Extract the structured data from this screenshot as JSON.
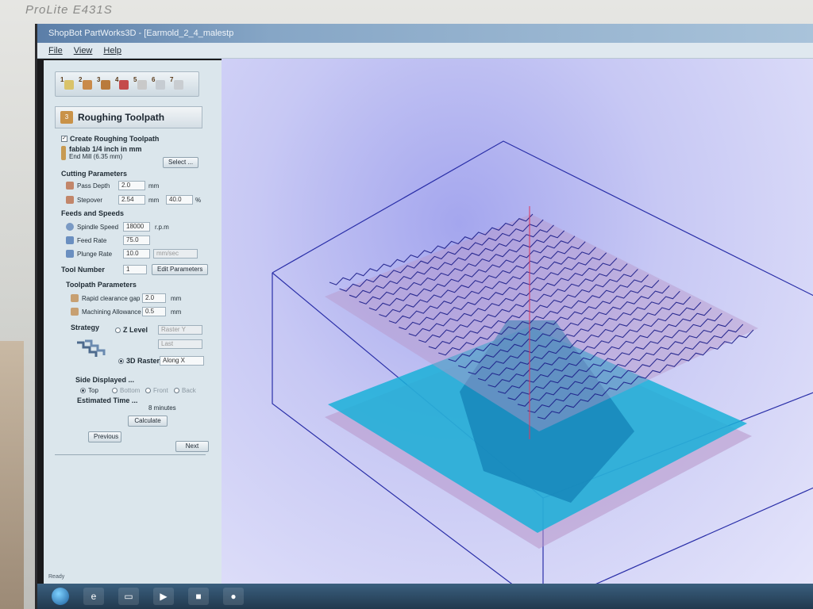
{
  "monitor": {
    "brand": "ProLite E431S"
  },
  "window": {
    "title": "ShopBot PartWorks3D - [Earmold_2_4_malestp"
  },
  "menu": [
    "File",
    "View",
    "Help"
  ],
  "steps": [
    "1",
    "2",
    "3",
    "4",
    "5",
    "6",
    "7"
  ],
  "panel": {
    "heading": "Roughing Toolpath",
    "create_label": "Create Roughing Toolpath",
    "create_checked": true,
    "tool_name": "fablab 1/4 inch in mm",
    "tool_type": "End Mill (6.35 mm)",
    "select_button": "Select ...",
    "cutting_title": "Cutting Parameters",
    "pass_depth_label": "Pass Depth",
    "pass_depth_value": "2.0",
    "pass_depth_unit": "mm",
    "stepover_label": "Stepover",
    "stepover_value": "2.54",
    "stepover_unit": "mm",
    "stepover_pct": "40.0",
    "pct_sign": "%",
    "feeds_title": "Feeds and Speeds",
    "spindle_label": "Spindle Speed",
    "spindle_value": "18000",
    "spindle_unit": "r.p.m",
    "feed_label": "Feed Rate",
    "feed_value": "75.0",
    "plunge_label": "Plunge Rate",
    "plunge_value": "10.0",
    "rate_unit": "mm/sec",
    "tool_number_label": "Tool Number",
    "tool_number_value": "1",
    "edit_params_button": "Edit Parameters",
    "toolpath_title": "Toolpath Parameters",
    "clearance_label": "Rapid clearance gap",
    "clearance_value": "2.0",
    "clearance_unit": "mm",
    "allowance_label": "Machining Allowance",
    "allowance_value": "0.5",
    "allowance_unit": "mm",
    "strategy_label": "Strategy",
    "zlevel_label": "Z Level",
    "zlevel_select": "Raster Y",
    "zlevel_select2": "Last",
    "raster_label": "3D Raster",
    "raster_select": "Along X",
    "side_title": "Side Displayed ...",
    "side_top": "Top",
    "side_bottom": "Bottom",
    "side_front": "Front",
    "side_back": "Back",
    "est_label": "Estimated Time ...",
    "est_value": "8 minutes",
    "calculate_button": "Calculate",
    "previous_button": "Previous",
    "next_button": "Next"
  },
  "status": {
    "text": "Ready"
  },
  "colors": {
    "viewport_bg": "#c7c8f4",
    "toolpath": "#1d1f8a",
    "model": "#1ab0d8",
    "stock_top": "#b896c8"
  }
}
